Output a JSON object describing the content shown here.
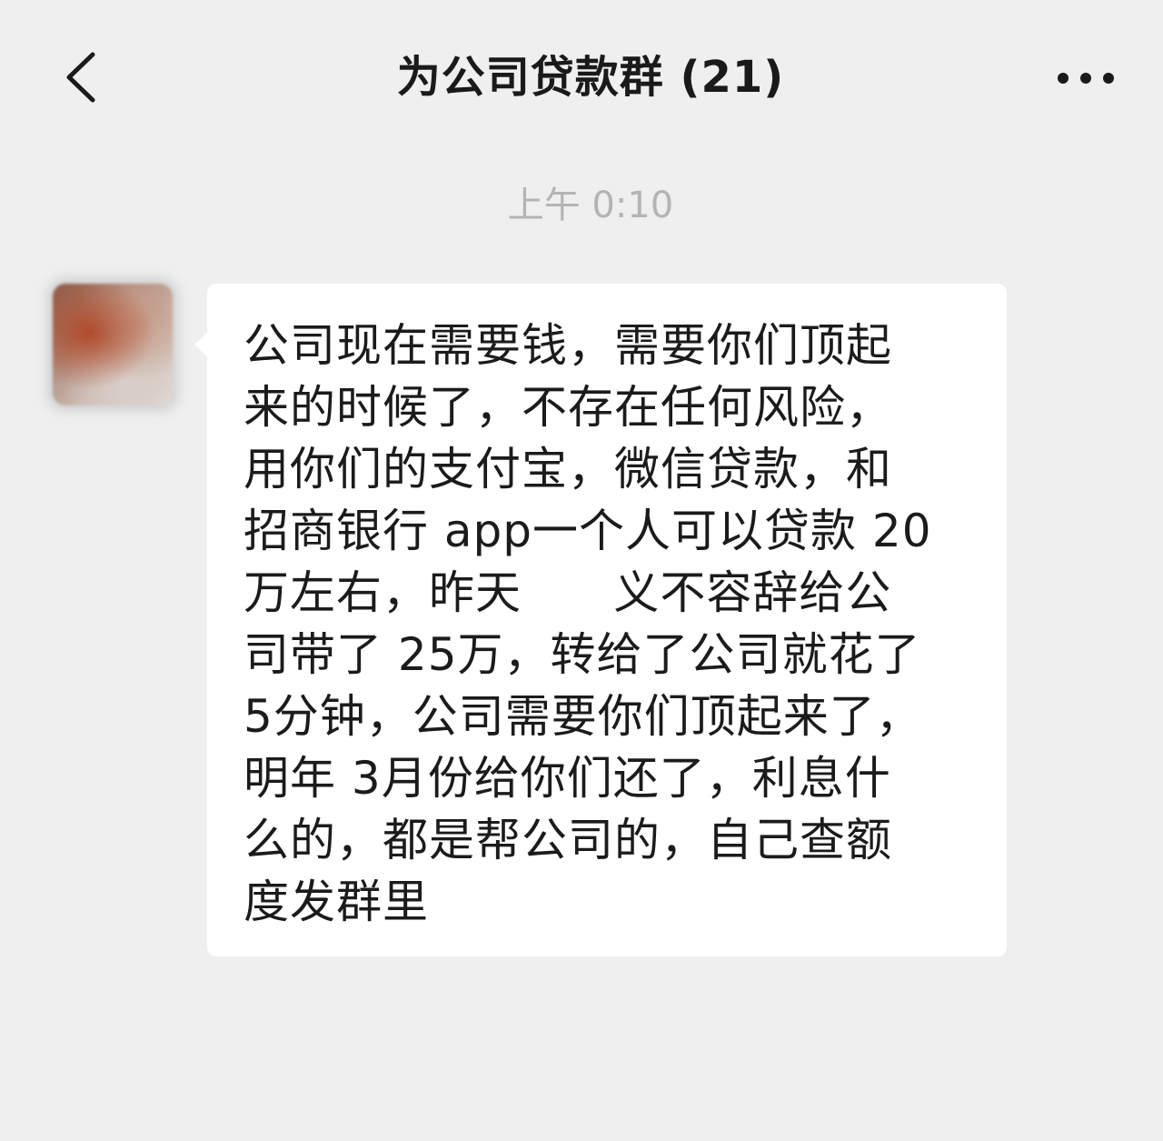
{
  "header": {
    "title": "为公司贷款群 (21)",
    "back_icon": "chevron-left-icon",
    "more_icon": "more-dots-icon"
  },
  "chat": {
    "timestamp": "上午 0:10",
    "message": {
      "lines": [
        "公司现在需要钱，需要你们顶起",
        "来的时候了，不存在任何风险，",
        "用你们的支付宝，微信贷款，和",
        "招商银行 app一个人可以贷款 20",
        "万左右，昨天      义不容辞给公",
        "司带了 25万，转给了公司就花了",
        "5分钟，公司需要你们顶起来了，",
        "明年 3月份给你们还了，利息什",
        "么的，都是帮公司的，自己查额",
        "度发群里"
      ]
    }
  },
  "colors": {
    "background": "#efefef",
    "bubble": "#ffffff",
    "text": "#1b1b1b",
    "timestamp": "#b4b4b4"
  }
}
